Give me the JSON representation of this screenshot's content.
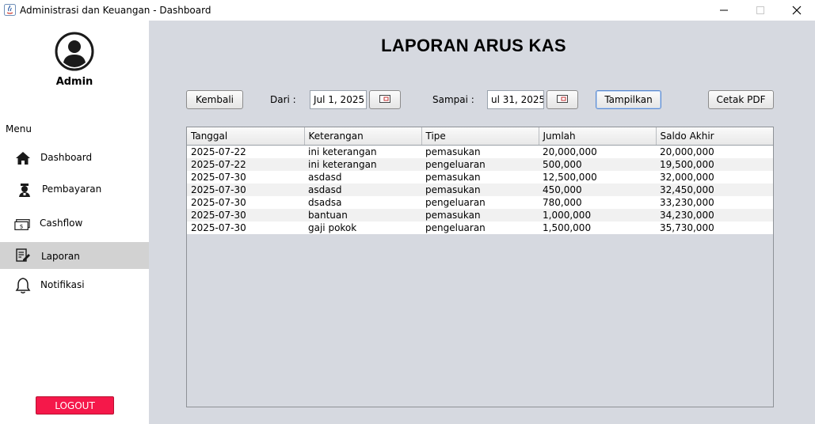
{
  "window": {
    "title": "Administrasi dan Keuangan - Dashboard"
  },
  "sidebar": {
    "user_name": "Admin",
    "menu_label": "Menu",
    "items": [
      {
        "label": "Dashboard",
        "icon": "home-icon"
      },
      {
        "label": "Pembayaran",
        "icon": "user-payment-icon"
      },
      {
        "label": "Cashflow",
        "icon": "money-icon"
      },
      {
        "label": "Laporan",
        "icon": "report-edit-icon"
      },
      {
        "label": "Notifikasi",
        "icon": "bell-icon"
      }
    ],
    "active_item": "Laporan",
    "logout_label": "LOGOUT"
  },
  "main": {
    "title": "LAPORAN ARUS KAS",
    "back_label": "Kembali",
    "from_label": "Dari :",
    "from_value": "Jul 1, 2025",
    "to_label": "Sampai :",
    "to_value": "ul 31, 2025",
    "show_label": "Tampilkan",
    "print_label": "Cetak PDF"
  },
  "table": {
    "columns": [
      "Tanggal",
      "Keterangan",
      "Tipe",
      "Jumlah",
      "Saldo Akhir"
    ],
    "rows": [
      [
        "2025-07-22",
        "ini keterangan",
        "pemasukan",
        "20,000,000",
        "20,000,000"
      ],
      [
        "2025-07-22",
        "ini keterangan",
        "pengeluaran",
        "500,000",
        "19,500,000"
      ],
      [
        "2025-07-30",
        "asdasd",
        "pemasukan",
        "12,500,000",
        "32,000,000"
      ],
      [
        "2025-07-30",
        "asdasd",
        "pemasukan",
        "450,000",
        "32,450,000"
      ],
      [
        "2025-07-30",
        "dsadsa",
        "pengeluaran",
        "780,000",
        "33,230,000"
      ],
      [
        "2025-07-30",
        "bantuan",
        "pemasukan",
        "1,000,000",
        "34,230,000"
      ],
      [
        "2025-07-30",
        "gaji pokok",
        "pengeluaran",
        "1,500,000",
        "35,730,000"
      ]
    ]
  },
  "colors": {
    "main_bg": "#d6d9e0",
    "logout_bg": "#f5184a",
    "active_nav_bg": "#d2d2d2"
  }
}
